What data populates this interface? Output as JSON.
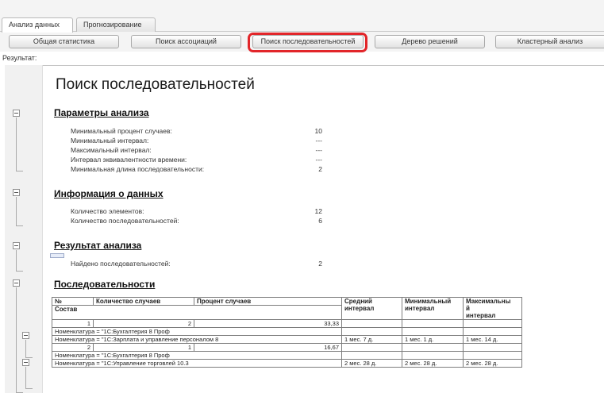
{
  "tabs": [
    {
      "label": "Анализ данных",
      "active": true
    },
    {
      "label": "Прогнозирование",
      "active": false
    }
  ],
  "toolbar": {
    "buttons": [
      "Общая статистика",
      "Поиск ассоциаций",
      "Поиск последовательностей",
      "Дерево решений",
      "Кластерный анализ"
    ],
    "highlighted": "Поиск последовательностей",
    "highlight_color": "#e2262a"
  },
  "result_label": "Результат:",
  "report": {
    "title": "Поиск последовательностей",
    "params": {
      "heading": "Параметры анализа",
      "rows": [
        {
          "label": "Минимальный процент случаев:",
          "value": "10"
        },
        {
          "label": "Минимальный интервал:",
          "value": "---"
        },
        {
          "label": "Максимальный интервал:",
          "value": "---"
        },
        {
          "label": "Интервал эквивалентности времени:",
          "value": "---"
        },
        {
          "label": "Минимальная длина последовательности:",
          "value": "2"
        }
      ]
    },
    "info": {
      "heading": "Информация о данных",
      "rows": [
        {
          "label": "Количество элементов:",
          "value": "12"
        },
        {
          "label": "Количество последовательностей:",
          "value": "6"
        }
      ]
    },
    "result": {
      "heading": "Результат анализа",
      "rows": [
        {
          "label": "Найдено последовательностей:",
          "value": "2"
        }
      ]
    },
    "sequences": {
      "heading": "Последовательности",
      "columns": {
        "no": "№",
        "count": "Количество случаев",
        "percent": "Процент случаев",
        "avg": "Средний интервал",
        "min": "Минимальный интервал",
        "max_line1": "Максимальны",
        "max_line2": "й",
        "max_line3": "интервал",
        "composition": "Состав"
      },
      "groups": [
        {
          "no": "1",
          "count": "2",
          "percent": "33,33",
          "items": [
            {
              "text": "Номенклатура =  \"1С:Бухгалтерия 8 Проф",
              "avg": "",
              "min": "",
              "max": ""
            },
            {
              "text": "Номенклатура =  \"1С:Зарплата и управление персоналом 8",
              "avg": "1 мес. 7 д.",
              "min": "1 мес. 1 д.",
              "max": "1 мес. 14 д."
            }
          ]
        },
        {
          "no": "2",
          "count": "1",
          "percent": "16,67",
          "items": [
            {
              "text": "Номенклатура =  \"1С:Бухгалтерия 8 Проф",
              "avg": "",
              "min": "",
              "max": ""
            },
            {
              "text": "Номенклатура =  \"1С:Управление торговлей 10.3",
              "avg": "2 мес. 28 д.",
              "min": "2 мес. 28 д.",
              "max": "2 мес. 28 д."
            }
          ]
        }
      ]
    }
  }
}
